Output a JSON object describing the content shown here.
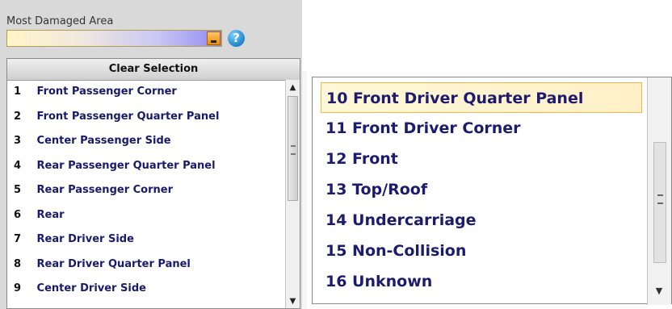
{
  "field": {
    "label": "Most Damaged Area",
    "help_icon": "help-icon",
    "dropdown_icon": "chevron-down-icon"
  },
  "dropdown": {
    "clear_label": "Clear Selection",
    "items": [
      {
        "num": "1",
        "label": "Front Passenger Corner"
      },
      {
        "num": "2",
        "label": "Front Passenger Quarter Panel"
      },
      {
        "num": "3",
        "label": "Center Passenger Side"
      },
      {
        "num": "4",
        "label": "Rear Passenger Quarter Panel"
      },
      {
        "num": "5",
        "label": "Rear Passenger Corner"
      },
      {
        "num": "6",
        "label": "Rear"
      },
      {
        "num": "7",
        "label": "Rear Driver Side"
      },
      {
        "num": "8",
        "label": "Rear Driver Quarter Panel"
      },
      {
        "num": "9",
        "label": "Center Driver Side"
      }
    ]
  },
  "right_list": {
    "items": [
      {
        "label": "10 Front Driver Quarter Panel",
        "selected": true
      },
      {
        "label": "11 Front Driver Corner",
        "selected": false
      },
      {
        "label": "12 Front",
        "selected": false
      },
      {
        "label": "13 Top/Roof",
        "selected": false
      },
      {
        "label": "14 Undercarriage",
        "selected": false
      },
      {
        "label": "15 Non-Collision",
        "selected": false
      },
      {
        "label": "16 Unknown",
        "selected": false
      }
    ]
  },
  "colors": {
    "item_text": "#1a1a6d",
    "selected_border": "#f0b74b",
    "combo_border": "#b69c4d"
  }
}
